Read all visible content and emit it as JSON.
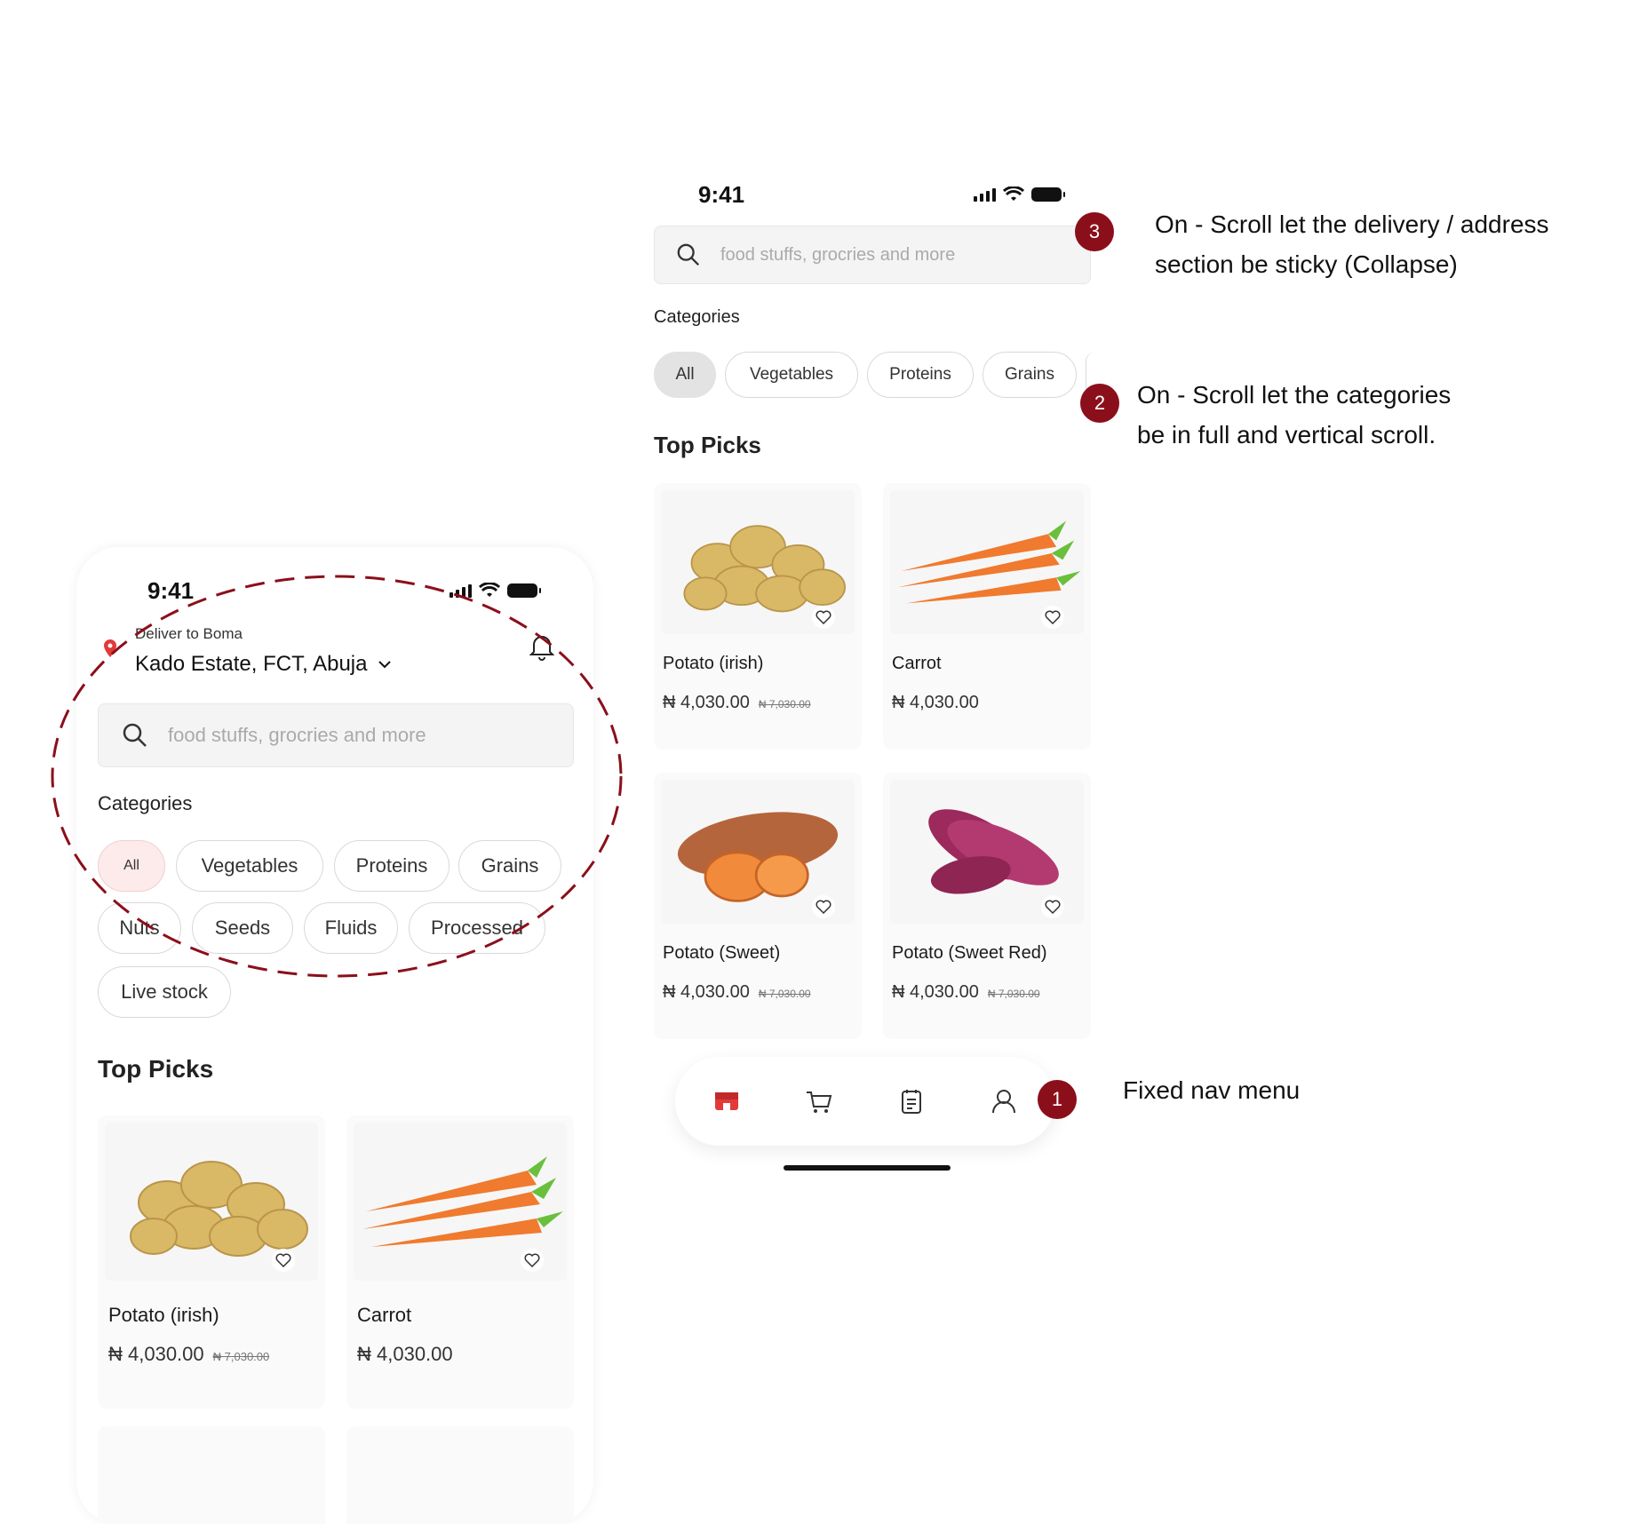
{
  "left_phone": {
    "status_time": "9:41",
    "deliver_label": "Deliver to Boma",
    "address": "Kado Estate, FCT, Abuja",
    "search_placeholder": "food stuffs, grocries and more",
    "categories_title": "Categories",
    "chips": [
      "All",
      "Vegetables",
      "Proteins",
      "Grains",
      "Nuts",
      "Seeds",
      "Fluids",
      "Processed",
      "Live stock"
    ],
    "top_picks_title": "Top Picks",
    "products": [
      {
        "name": "Potato (irish)",
        "price": "₦ 4,030.00",
        "old_price": "₦ 7,030.00"
      },
      {
        "name": "Carrot",
        "price": "₦ 4,030.00",
        "old_price": ""
      }
    ]
  },
  "right_phone": {
    "status_time": "9:41",
    "search_placeholder": "food stuffs, grocries and more",
    "categories_title": "Categories",
    "chips": [
      "All",
      "Vegetables",
      "Proteins",
      "Grains"
    ],
    "top_picks_title": "Top Picks",
    "products": [
      {
        "name": "Potato (irish)",
        "price": "₦ 4,030.00",
        "old_price": "₦ 7,030.00"
      },
      {
        "name": "Carrot",
        "price": "₦ 4,030.00",
        "old_price": ""
      },
      {
        "name": "Potato (Sweet)",
        "price": "₦ 4,030.00",
        "old_price": "₦ 7,030.00"
      },
      {
        "name": "Potato (Sweet Red)",
        "price": "₦ 4,030.00",
        "old_price": "₦ 7,030.00"
      }
    ],
    "nav_items": [
      "store-icon",
      "cart-icon",
      "orders-icon",
      "profile-icon"
    ]
  },
  "annotations": [
    {
      "number": "3",
      "text_line1": "On - Scroll let the delivery / address",
      "text_line2": "section be sticky (Collapse)"
    },
    {
      "number": "2",
      "text_line1": "On - Scroll let the categories",
      "text_line2": "be in full and vertical scroll."
    },
    {
      "number": "1",
      "text_line1": "Fixed nav menu",
      "text_line2": ""
    }
  ],
  "colors": {
    "accent": "#8b0f1a",
    "chip_active_bg": "#fdeaea",
    "chip_active_gray": "#e3e3e3"
  }
}
